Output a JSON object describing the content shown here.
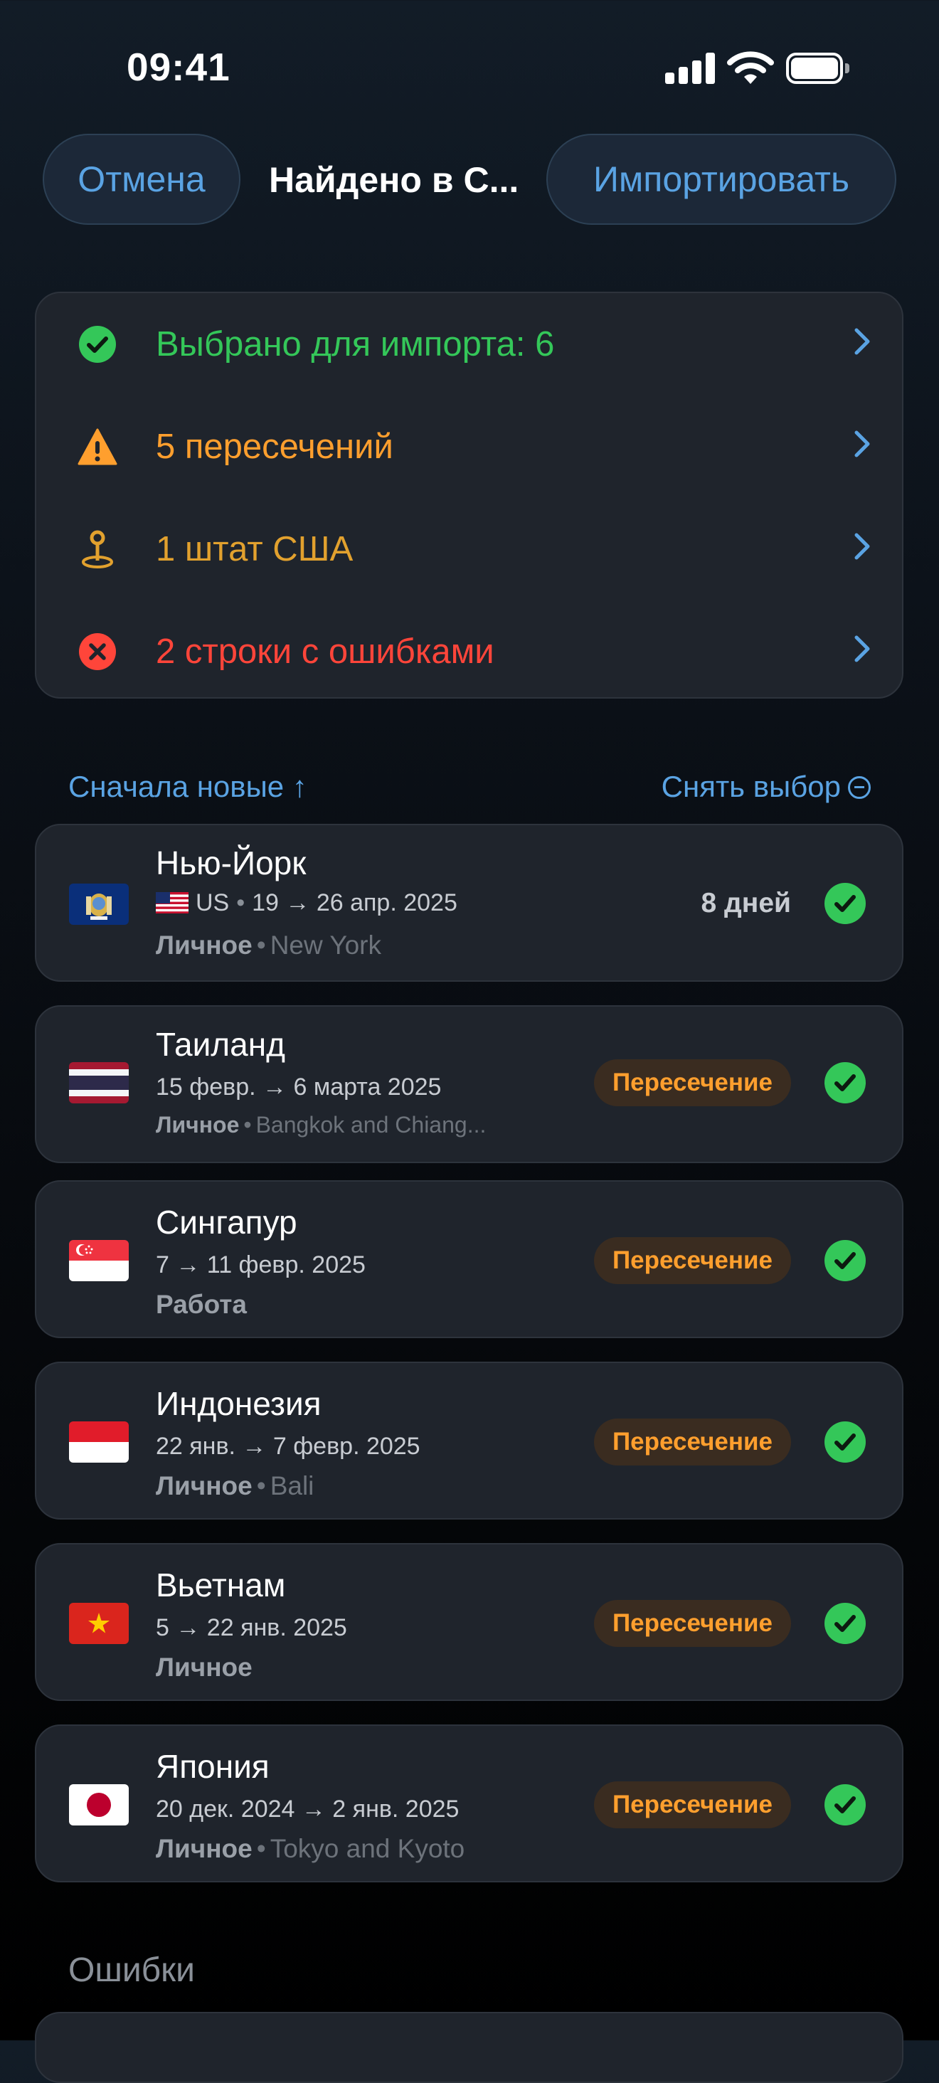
{
  "status_bar": {
    "time": "09:41"
  },
  "nav": {
    "cancel_label": "Отмена",
    "title": "Найдено в С...",
    "import_label": "Импортировать"
  },
  "summary": {
    "rows": [
      {
        "label": "Выбрано для импорта: 6",
        "icon": "checkmark-circle-icon",
        "color": "#34c759"
      },
      {
        "label": "5 пересечений",
        "icon": "warning-triangle-icon",
        "color": "#ff9f2e"
      },
      {
        "label": "1 штат США",
        "icon": "map-pin-icon",
        "color": "#e2a12e"
      },
      {
        "label": "2 строки с ошибками",
        "icon": "error-x-circle-icon",
        "color": "#ff453a"
      }
    ]
  },
  "sort": {
    "order_label": "Сначала новые ↑",
    "deselect_label": "Снять выбор"
  },
  "trips": [
    {
      "name": "Нью-Йорк",
      "flag": "new-york-state-flag",
      "country_code": "US",
      "dates": "19 → 26 апр. 2025",
      "category": "Личное",
      "location": "New York",
      "duration": "8 дней",
      "selected": true
    },
    {
      "name": "Таиланд",
      "flag": "thailand-flag",
      "dates": "15 февр. → 6 марта 2025",
      "category": "Личное",
      "location": "Bangkok and Chiang...",
      "badge": "Пересечение",
      "selected": true
    },
    {
      "name": "Сингапур",
      "flag": "singapore-flag",
      "dates": "7 → 11 февр. 2025",
      "category": "Работа",
      "badge": "Пересечение",
      "selected": true
    },
    {
      "name": "Индонезия",
      "flag": "indonesia-flag",
      "dates": "22 янв. → 7 февр. 2025",
      "category": "Личное",
      "location": "Bali",
      "badge": "Пересечение",
      "selected": true
    },
    {
      "name": "Вьетнам",
      "flag": "vietnam-flag",
      "dates": "5 → 22 янв. 2025",
      "category": "Личное",
      "badge": "Пересечение",
      "selected": true
    },
    {
      "name": "Япония",
      "flag": "japan-flag",
      "dates": "20 дек. 2024 → 2 янв. 2025",
      "category": "Личное",
      "location": "Tokyo and Kyoto",
      "badge": "Пересечение",
      "selected": true
    }
  ],
  "errors_section": {
    "title": "Ошибки"
  },
  "colors": {
    "accent": "#5aa3e3",
    "success": "#34c759",
    "warning": "#ff9f2e",
    "error": "#ff453a",
    "card_bg": "#1f242c"
  }
}
